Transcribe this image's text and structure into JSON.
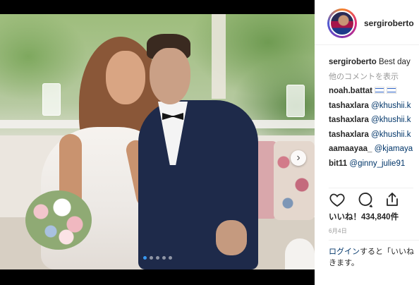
{
  "post": {
    "carousel": {
      "total": 5,
      "active": 0,
      "next_glyph": "›"
    }
  },
  "header": {
    "username": "sergiroberto"
  },
  "caption": {
    "username": "sergiroberto",
    "text": "Best day"
  },
  "more_comments_label": "他のコメントを表示",
  "comments": [
    {
      "user": "noah.battat",
      "text": "",
      "flags": 2
    },
    {
      "user": "tashaxlara",
      "text": "@khushii.k"
    },
    {
      "user": "tashaxlara",
      "text": "@khushii.k"
    },
    {
      "user": "tashaxlara",
      "text": "@khushii.k"
    },
    {
      "user": "aamaayaa_",
      "text": "@kjamaya"
    },
    {
      "user": "bit11",
      "text": "@ginny_julie91"
    }
  ],
  "likes": "いいね！434,840件",
  "date": "6月4日",
  "login": {
    "link": "ログイン",
    "line1": "すると「いいね",
    "line2": "きます。"
  },
  "colors": {
    "accent": "#3897f0",
    "link": "#003569",
    "text": "#262626",
    "muted": "#999999"
  },
  "icons": [
    "heart-icon",
    "comment-icon",
    "share-icon",
    "chevron-right-icon"
  ]
}
